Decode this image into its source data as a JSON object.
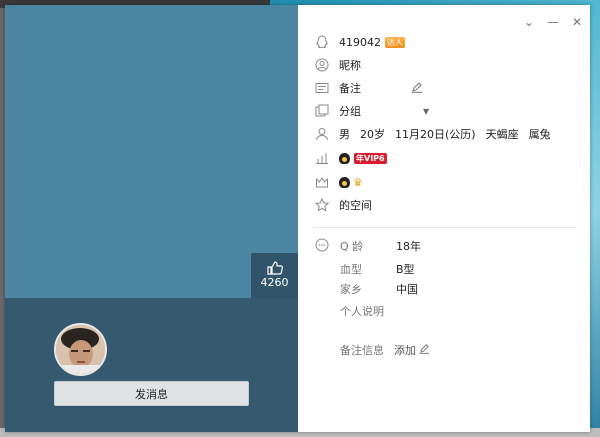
{
  "profile": {
    "qq_number": "419042",
    "badge_talent": "达人",
    "nickname_label": "昵称",
    "remark_label": "备注",
    "group_label": "分组",
    "gender": "男",
    "age": "20岁",
    "birthday": "11月20日(公历)",
    "constellation": "天蝎座",
    "zodiac": "属兔",
    "vip_badge": "年VIP6",
    "space_label": "的空间"
  },
  "details": {
    "q_age_label": "Q 龄",
    "q_age_value": "18年",
    "blood_label": "血型",
    "blood_value": "B型",
    "hometown_label": "家乡",
    "hometown_value": "中国",
    "bio_label": "个人说明",
    "note_label": "备注信息",
    "note_add": "添加"
  },
  "left_panel": {
    "like_count": "4260",
    "send_message": "发消息"
  },
  "colors": {
    "cover_top": "#4c86a3",
    "cover_bottom": "#35596f",
    "vip_red": "#d81e2c"
  }
}
